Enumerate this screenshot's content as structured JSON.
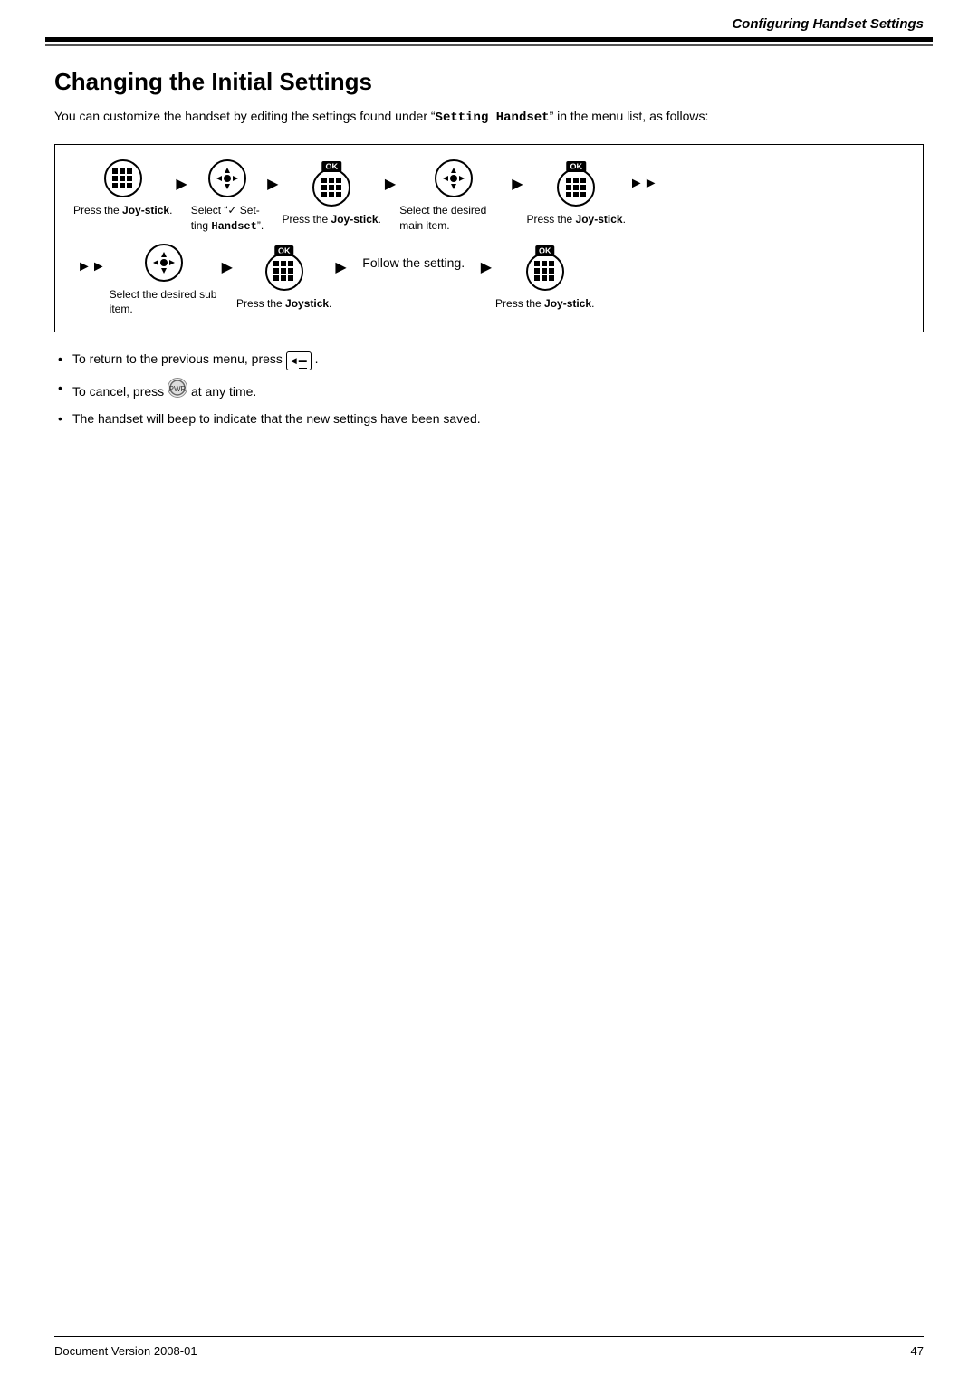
{
  "header": {
    "title": "Configuring Handset Settings"
  },
  "page": {
    "title": "Changing the Initial Settings",
    "intro": "You can customize the handset by editing the settings found under “Setting Handset” in the menu list, as follows:"
  },
  "steps": {
    "row1": [
      {
        "icon": "grid",
        "label": "Press the Joy-stick.",
        "ok": false
      },
      {
        "icon": "joystick",
        "label": "Select “✓ Setting Handset”.",
        "ok": false
      },
      {
        "icon": "grid",
        "label": "Press the Joy-stick.",
        "ok": true
      },
      {
        "icon": "joystick",
        "label": "Select the desired main item.",
        "ok": false
      },
      {
        "icon": "grid",
        "label": "Press the Joy-stick.",
        "ok": true
      }
    ],
    "row2": [
      {
        "icon": "joystick",
        "label": "Select the desired sub item.",
        "ok": false
      },
      {
        "icon": "grid",
        "label": "Press the Joystick.",
        "ok": true
      },
      {
        "text": "Follow the setting.",
        "ok": false
      },
      {
        "icon": "grid",
        "label": "Press the Joy-stick.",
        "ok": true
      }
    ]
  },
  "bullets": [
    {
      "text_before": "To return to the previous menu, press",
      "icon": "back",
      "text_after": "."
    },
    {
      "text_before": "To cancel, press",
      "icon": "cancel",
      "text_after": "at any time."
    },
    {
      "text_only": "The handset will beep to indicate that the new settings have been saved."
    }
  ],
  "footer": {
    "left": "Document Version 2008-01",
    "right": "47"
  }
}
